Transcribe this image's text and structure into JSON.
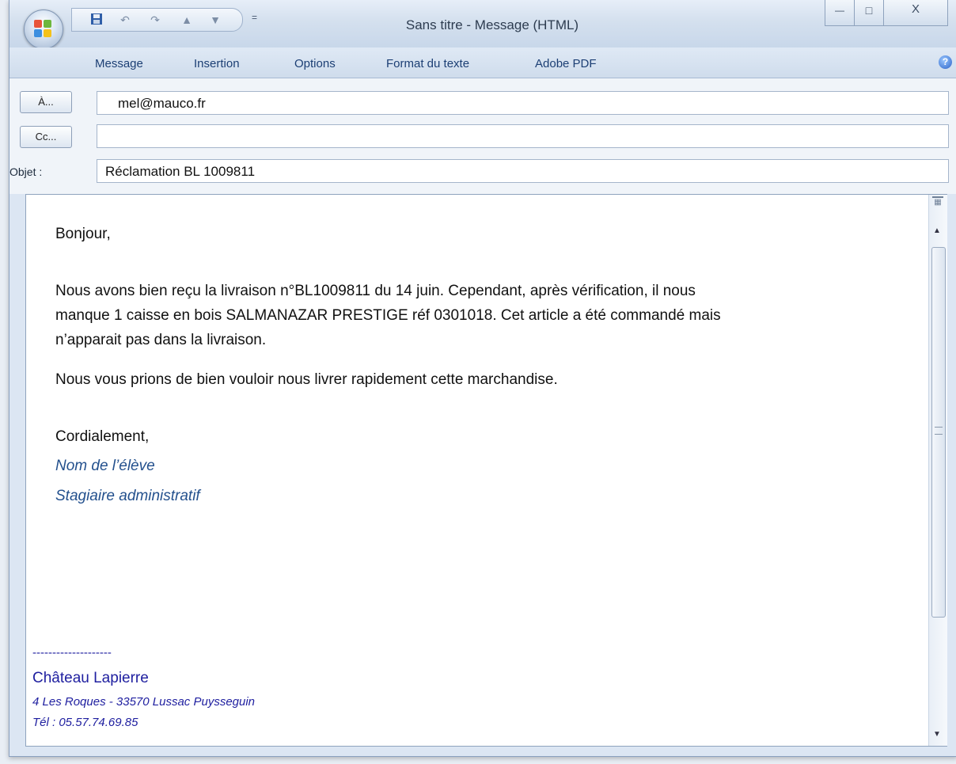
{
  "window": {
    "title": "Sans titre - Message (HTML)",
    "controls": {
      "minimize": "—",
      "maximize": "□",
      "close": "X"
    }
  },
  "quick_access": {
    "save_icon": "save-icon",
    "undo_icon": "undo-icon",
    "redo_icon": "redo-icon",
    "up_icon": "arrow-up-icon",
    "down_icon": "arrow-down-icon",
    "dropdown": "="
  },
  "ribbon": {
    "tabs": [
      "Message",
      "Insertion",
      "Options",
      "Format du texte",
      "Adobe PDF"
    ],
    "help": "?"
  },
  "header": {
    "to_button": "À...",
    "cc_button": "Cc...",
    "subject_label": "Objet :",
    "to_value": "mel@mauco.fr",
    "cc_value": "",
    "subject_value": "Réclamation BL 1009811"
  },
  "body": {
    "greeting": "Bonjour,",
    "paragraph1_line1": "Nous avons bien reçu la livraison n°BL1009811 du 14 juin. Cependant, après vérification, il nous",
    "paragraph1_line2": "manque 1 caisse en bois SALMANAZAR PRESTIGE réf 0301018. Cet article a été commandé mais",
    "paragraph1_line3": "n’apparait pas dans la livraison.",
    "paragraph2": "Nous vous prions de bien vouloir nous livrer rapidement cette marchandise.",
    "closing": "Cordialement,",
    "name": "Nom de l’élève",
    "role": "Stagiaire administratif"
  },
  "signature": {
    "separator": "--------------------",
    "company": "Château Lapierre",
    "address": "4 Les Roques - 33570 Lussac Puysseguin",
    "phone": "Tél : 05.57.74.69.85"
  },
  "colors": {
    "accent_blue": "#23508d",
    "signature_blue": "#2020a0",
    "tab_text": "#1c3f74"
  }
}
